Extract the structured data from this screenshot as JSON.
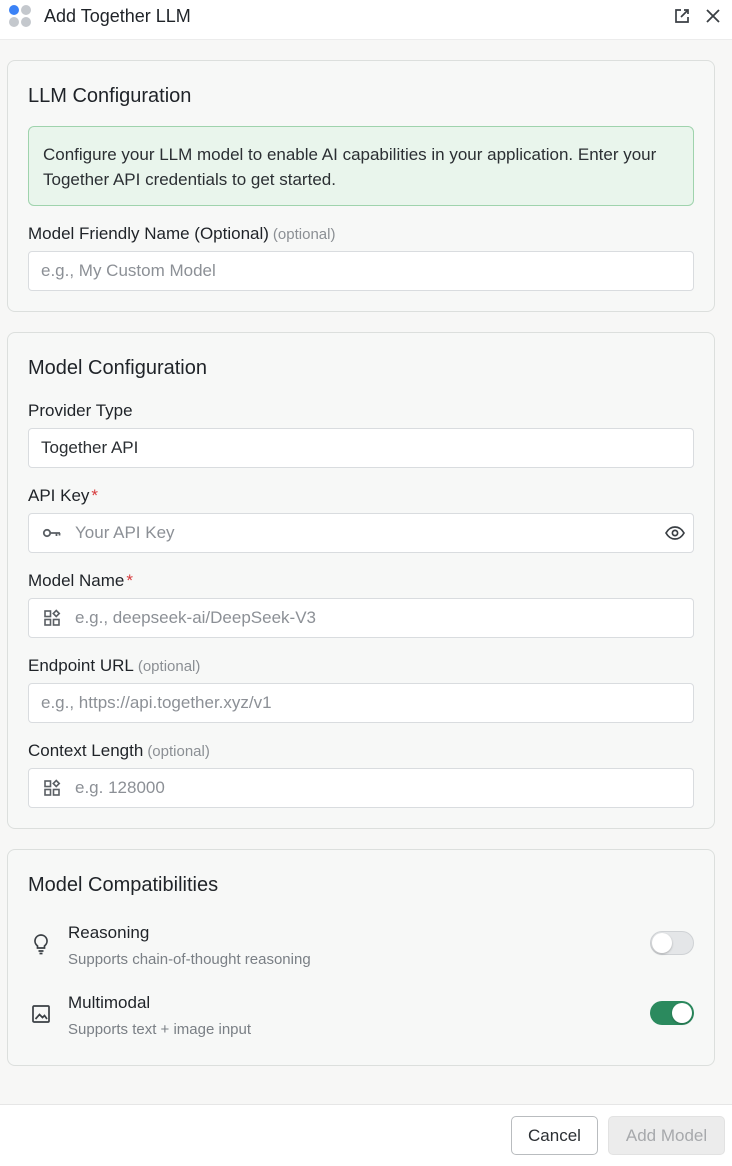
{
  "window": {
    "title": "Add Together LLM",
    "logo_colors": [
      "#3b82f6",
      "#9ca3af",
      "#c4c8cd",
      "#d1d5db"
    ]
  },
  "llm_config": {
    "title": "LLM Configuration",
    "info": "Configure your LLM model to enable AI capabilities in your application. Enter your Together API credentials to get started.",
    "friendly_name": {
      "label": "Model Friendly Name (Optional)",
      "optional": "(optional)",
      "placeholder": "e.g., My Custom Model"
    }
  },
  "model_config": {
    "title": "Model Configuration",
    "provider_type": {
      "label": "Provider Type",
      "value": "Together API"
    },
    "api_key": {
      "label": "API Key",
      "required": "*",
      "placeholder": "Your API Key",
      "icon": "key-icon",
      "trail_icon": "eye-icon"
    },
    "model_name": {
      "label": "Model Name",
      "required": "*",
      "placeholder": "e.g., deepseek-ai/DeepSeek-V3",
      "icon": "widgets-icon"
    },
    "endpoint_url": {
      "label": "Endpoint URL",
      "optional": "(optional)",
      "placeholder": "e.g., https://api.together.xyz/v1"
    },
    "context_length": {
      "label": "Context Length",
      "optional": "(optional)",
      "placeholder": "e.g. 128000",
      "icon": "widgets-icon"
    }
  },
  "compat": {
    "title": "Model Compatibilities",
    "items": [
      {
        "name": "Reasoning",
        "desc": "Supports chain-of-thought reasoning",
        "icon": "lightbulb-icon",
        "enabled": false
      },
      {
        "name": "Multimodal",
        "desc": "Supports text + image input",
        "icon": "image-icon",
        "enabled": true
      }
    ]
  },
  "footer": {
    "cancel": "Cancel",
    "submit": "Add Model"
  },
  "colors": {
    "accent": "#2b8a5e",
    "required": "#d6393b",
    "info_bg": "#e9f5ec"
  }
}
